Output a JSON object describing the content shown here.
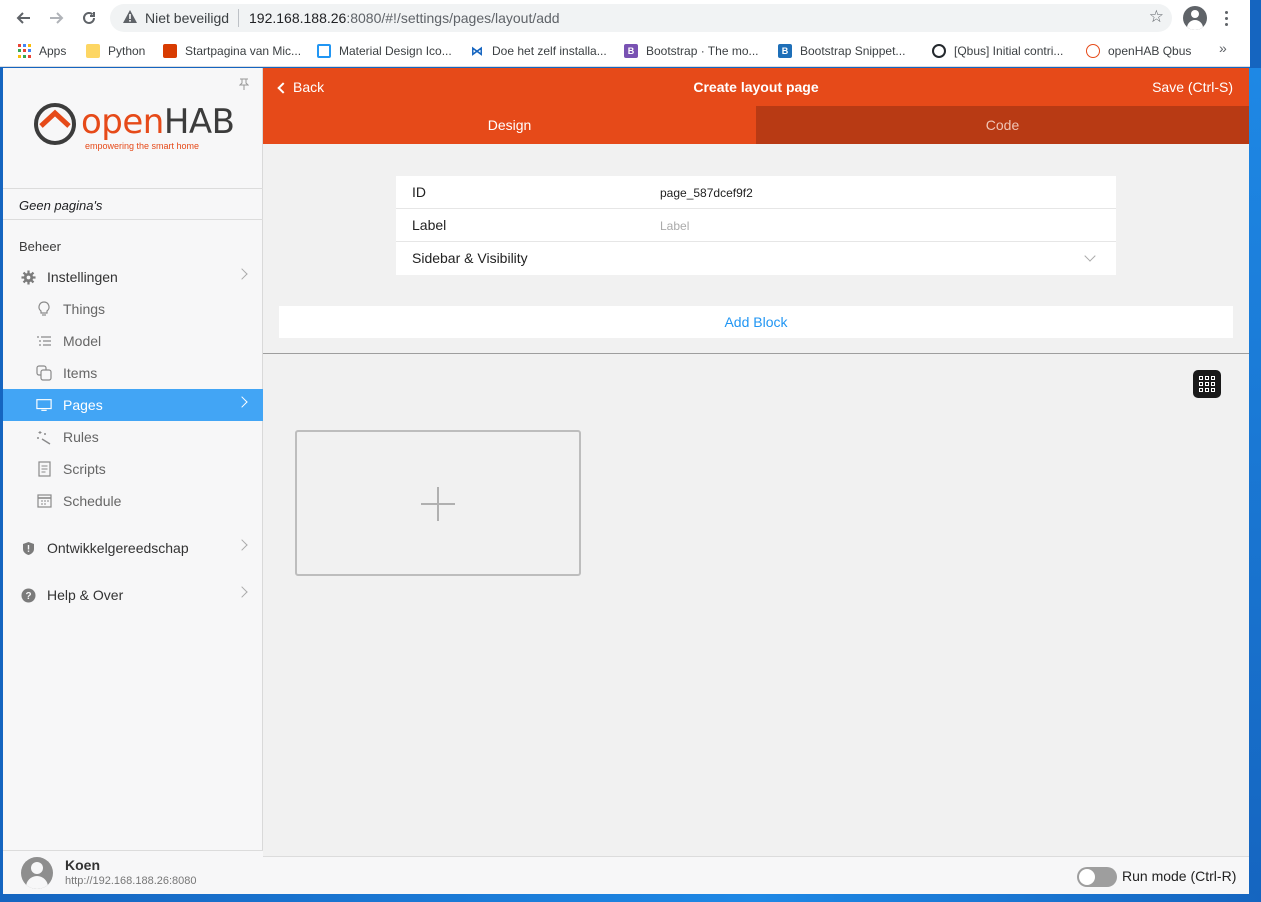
{
  "browser": {
    "security": "Niet beveiligd",
    "url_host": "192.168.188.26",
    "url_path": ":8080/#!/settings/pages/layout/add",
    "bookmarks": [
      {
        "label": "Apps",
        "color": "#4285f4"
      },
      {
        "label": "Python",
        "color": "#fdd663"
      },
      {
        "label": "Startpagina van Mic...",
        "color": "#d83b01"
      },
      {
        "label": "Material Design Ico...",
        "color": "#2196f3"
      },
      {
        "label": "Doe het zelf installa...",
        "color": "#1565c0"
      },
      {
        "label": "Bootstrap · The mo...",
        "color": "#7952b3"
      },
      {
        "label": "Bootstrap Snippet...",
        "color": "#1e6fb8"
      },
      {
        "label": "[Qbus] Initial contri...",
        "color": "#24292e"
      },
      {
        "label": "openHAB Qbus",
        "color": "#e64a19"
      }
    ],
    "more": "»"
  },
  "sidebar": {
    "logo_open": "open",
    "logo_hab": "HAB",
    "logo_tagline": "empowering the smart home",
    "no_pages": "Geen pagina's",
    "section_title": "Beheer",
    "items": [
      {
        "label": "Instellingen",
        "icon": "gear-icon"
      },
      {
        "label": "Things",
        "icon": "lightbulb-icon"
      },
      {
        "label": "Model",
        "icon": "list-icon"
      },
      {
        "label": "Items",
        "icon": "items-icon"
      },
      {
        "label": "Pages",
        "icon": "monitor-icon"
      },
      {
        "label": "Rules",
        "icon": "wand-icon"
      },
      {
        "label": "Scripts",
        "icon": "script-icon"
      },
      {
        "label": "Schedule",
        "icon": "calendar-icon"
      },
      {
        "label": "Ontwikkelgereedschap",
        "icon": "shield-icon"
      },
      {
        "label": "Help & Over",
        "icon": "help-icon"
      }
    ],
    "user_name": "Koen",
    "user_url": "http://192.168.188.26:8080"
  },
  "header": {
    "back": "Back",
    "title": "Create layout page",
    "save": "Save (Ctrl-S)"
  },
  "tabs": [
    "Design",
    "Code"
  ],
  "form": {
    "id_label": "ID",
    "id_value": "page_587dcef9f2",
    "label_label": "Label",
    "label_placeholder": "Label",
    "sidebar_label": "Sidebar & Visibility"
  },
  "add_block": "Add Block",
  "footer": {
    "run_mode": "Run mode (Ctrl-R)"
  },
  "colors": {
    "brand": "#e64a19",
    "active_nav": "#42a5f5",
    "link": "#2196f3"
  }
}
